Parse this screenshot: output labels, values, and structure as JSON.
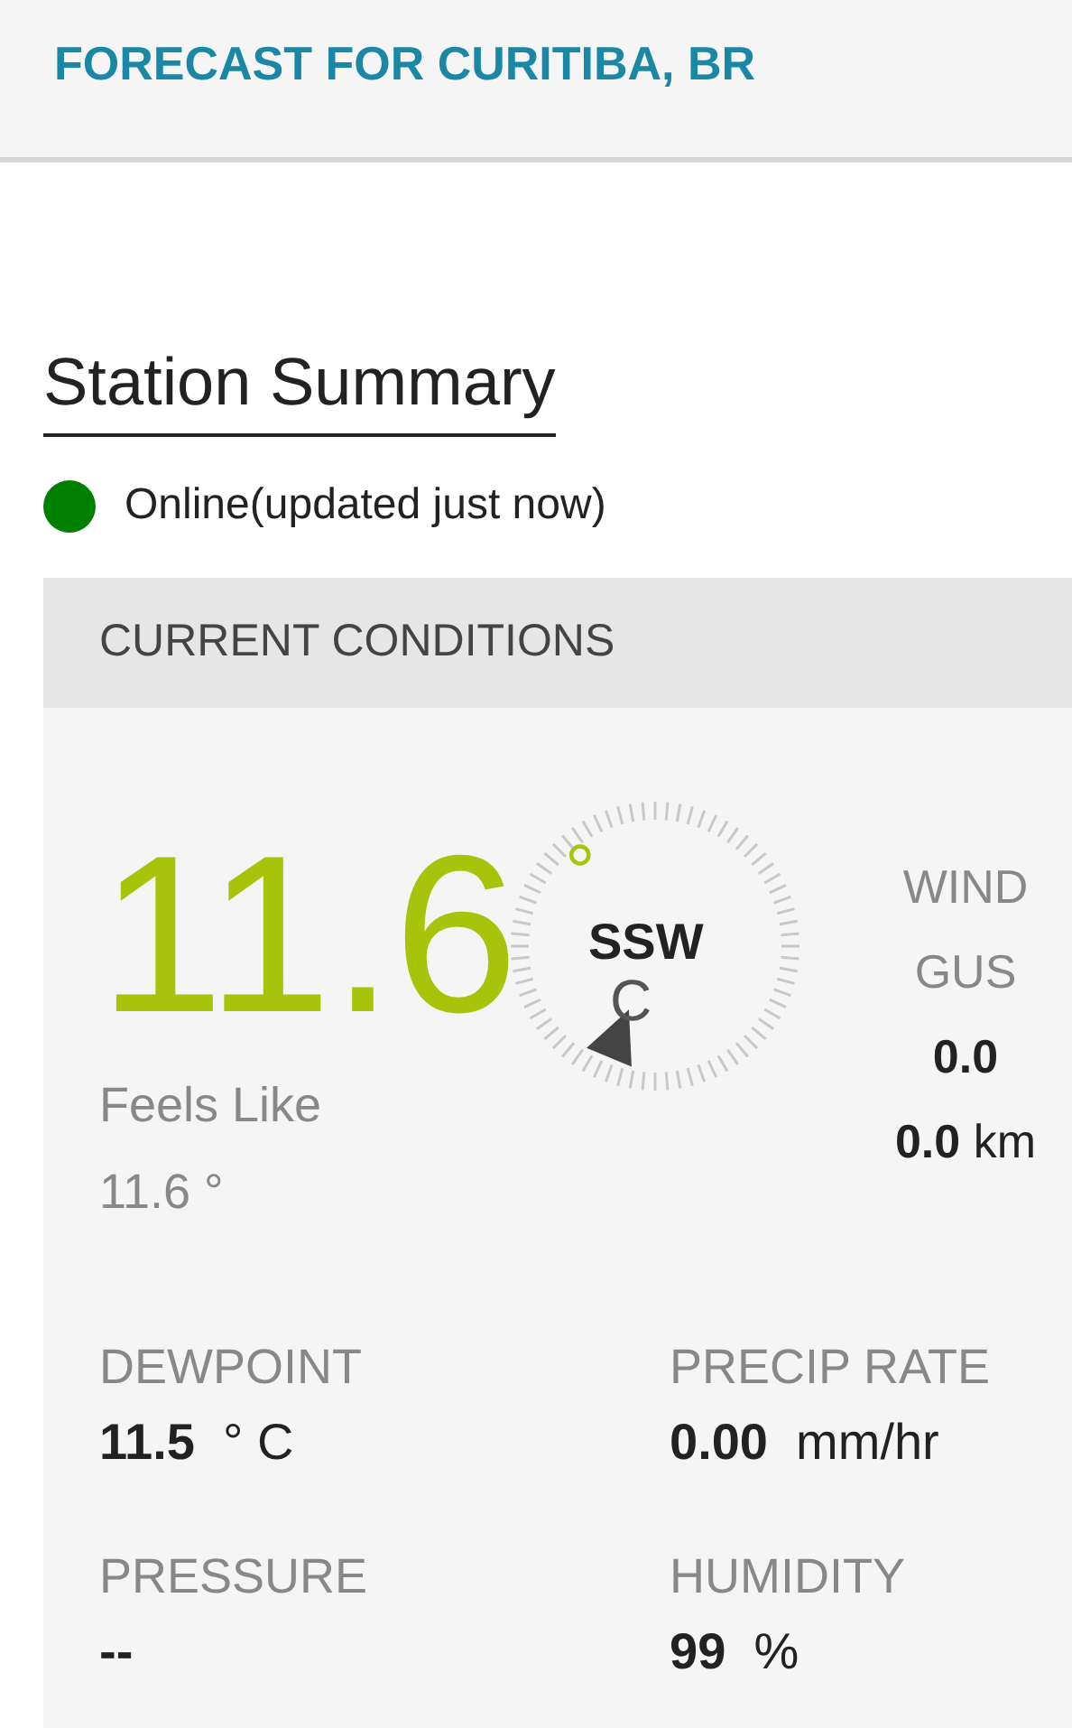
{
  "header": {
    "title": "FORECAST FOR CURITIBA, BR"
  },
  "station": {
    "heading": "Station Summary",
    "status": {
      "text": "Online(updated just now)",
      "color": "#008000"
    }
  },
  "current": {
    "title": "CURRENT CONDITIONS",
    "temperature": {
      "value": "11.6",
      "degree": "°",
      "unit": "C"
    },
    "compass": {
      "direction": "SSW"
    },
    "feels_like": {
      "label": "Feels Like",
      "value": "11.6 °"
    },
    "wind": {
      "label": "WIND",
      "gust_label": "GUS",
      "value": "0.0",
      "gust_value": "0.0",
      "gust_unit": "km"
    },
    "metrics": [
      {
        "label": "DEWPOINT",
        "value": "11.5",
        "unit": "° C"
      },
      {
        "label": "PRECIP RATE",
        "value": "0.00",
        "unit": "mm/hr"
      },
      {
        "label": "PRESSURE",
        "value": "--"
      },
      {
        "label": "HUMIDITY",
        "value": "99",
        "unit": "%"
      }
    ]
  }
}
